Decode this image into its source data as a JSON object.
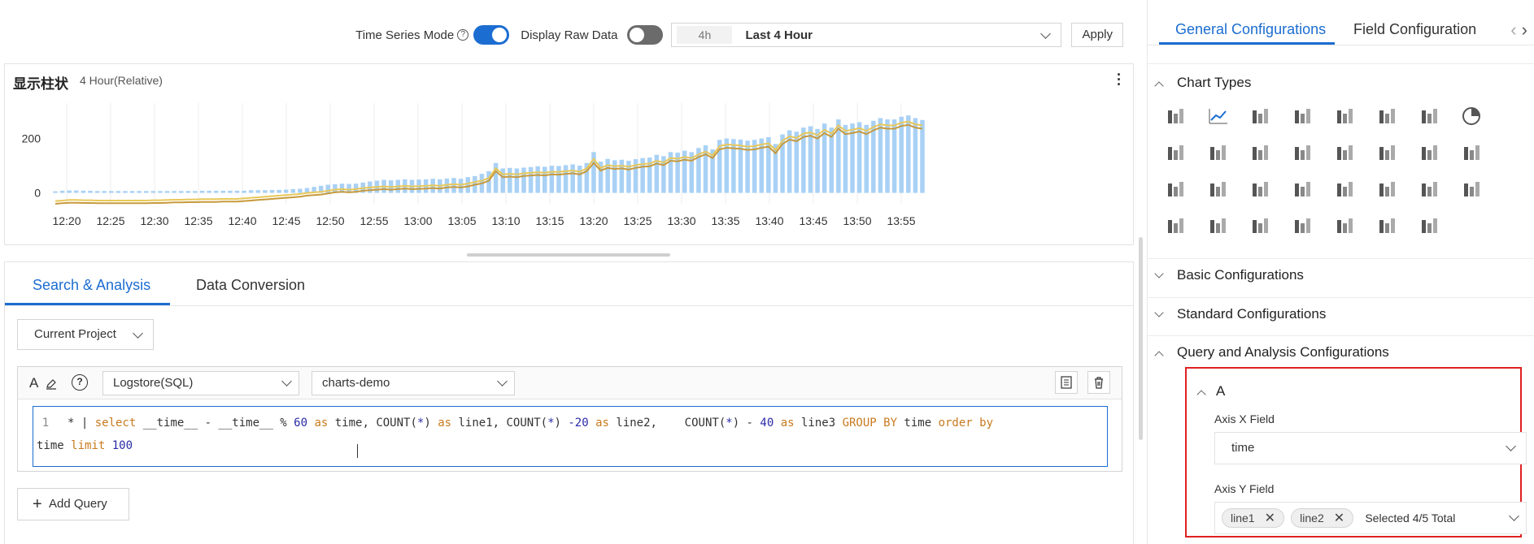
{
  "toolbar": {
    "time_series_label": "Time Series Mode",
    "time_series_on": true,
    "raw_data_label": "Display Raw Data",
    "raw_data_on": false,
    "time_chip": "4h",
    "time_range": "Last 4 Hour",
    "apply_label": "Apply"
  },
  "chart": {
    "title": "显示柱状",
    "subtitle": "4 Hour(Relative)"
  },
  "chart_data": {
    "type": "bar",
    "y_ticks": [
      0,
      200
    ],
    "ylim": [
      -40,
      330
    ],
    "x_ticks": [
      "12:20",
      "12:25",
      "12:30",
      "12:35",
      "12:40",
      "12:45",
      "12:50",
      "12:55",
      "13:00",
      "13:05",
      "13:10",
      "13:15",
      "13:20",
      "13:25",
      "13:30",
      "13:35",
      "13:40",
      "13:45",
      "13:50",
      "13:55"
    ],
    "bar_color": "#a9d1f5",
    "line_colors": [
      "#e8c85a",
      "#c79a3c"
    ],
    "bar_values": [
      6,
      8,
      9,
      9,
      8,
      8,
      7,
      7,
      7,
      7,
      7,
      7,
      7,
      7,
      7,
      7,
      7,
      7,
      7,
      7,
      7,
      8,
      8,
      8,
      8,
      8,
      8,
      8,
      10,
      10,
      10,
      11,
      11,
      12,
      14,
      15,
      18,
      22,
      26,
      30,
      32,
      34,
      33,
      34,
      38,
      42,
      45,
      48,
      46,
      48,
      50,
      48,
      49,
      50,
      52,
      50,
      53,
      55,
      52,
      58,
      62,
      70,
      80,
      110,
      90,
      92,
      90,
      93,
      95,
      98,
      96,
      100,
      99,
      102,
      105,
      100,
      110,
      150,
      115,
      125,
      120,
      122,
      118,
      124,
      128,
      130,
      140,
      135,
      150,
      148,
      155,
      150,
      165,
      175,
      160,
      195,
      200,
      198,
      196,
      192,
      195,
      200,
      205,
      180,
      215,
      230,
      225,
      240,
      245,
      235,
      255,
      240,
      270,
      250,
      255,
      260,
      250,
      265,
      275,
      270,
      270,
      280,
      285,
      275,
      268
    ],
    "line1": [
      -30,
      -28,
      -26,
      -26,
      -27,
      -27,
      -28,
      -28,
      -28,
      -28,
      -28,
      -28,
      -28,
      -28,
      -27,
      -27,
      -26,
      -25,
      -25,
      -24,
      -24,
      -23,
      -23,
      -23,
      -22,
      -22,
      -22,
      -20,
      -18,
      -16,
      -14,
      -12,
      -10,
      -8,
      -6,
      -4,
      0,
      2,
      4,
      8,
      12,
      14,
      12,
      14,
      18,
      20,
      22,
      24,
      22,
      24,
      26,
      24,
      25,
      26,
      28,
      26,
      30,
      32,
      30,
      34,
      40,
      45,
      55,
      90,
      68,
      70,
      68,
      72,
      74,
      76,
      74,
      78,
      77,
      80,
      82,
      78,
      90,
      125,
      92,
      102,
      98,
      100,
      96,
      102,
      106,
      108,
      118,
      112,
      128,
      126,
      132,
      128,
      142,
      152,
      138,
      172,
      178,
      176,
      174,
      170,
      172,
      178,
      182,
      158,
      192,
      208,
      202,
      218,
      222,
      212,
      232,
      218,
      248,
      228,
      232,
      238,
      228,
      242,
      252,
      248,
      248,
      258,
      262,
      252,
      248
    ],
    "line2": [
      -40,
      -38,
      -36,
      -36,
      -37,
      -37,
      -38,
      -38,
      -38,
      -38,
      -38,
      -38,
      -38,
      -38,
      -37,
      -37,
      -36,
      -35,
      -35,
      -34,
      -34,
      -33,
      -33,
      -33,
      -32,
      -32,
      -32,
      -30,
      -28,
      -26,
      -24,
      -22,
      -20,
      -18,
      -16,
      -14,
      -10,
      -8,
      -6,
      -2,
      2,
      4,
      2,
      4,
      8,
      10,
      12,
      14,
      12,
      14,
      16,
      14,
      15,
      16,
      18,
      16,
      20,
      22,
      20,
      24,
      30,
      35,
      45,
      80,
      58,
      60,
      58,
      62,
      64,
      66,
      64,
      68,
      67,
      70,
      72,
      68,
      80,
      110,
      82,
      92,
      88,
      90,
      86,
      92,
      96,
      98,
      108,
      102,
      118,
      116,
      122,
      118,
      132,
      142,
      128,
      160,
      166,
      164,
      162,
      158,
      160,
      166,
      170,
      146,
      180,
      196,
      190,
      206,
      210,
      200,
      220,
      206,
      236,
      216,
      220,
      226,
      216,
      230,
      240,
      236,
      236,
      246,
      250,
      240,
      236
    ]
  },
  "search": {
    "tabs": [
      "Search & Analysis",
      "Data Conversion"
    ],
    "project": "Current Project",
    "store_type": "Logstore(SQL)",
    "logstore": "charts-demo",
    "line_number": "1",
    "query_line1_tokens": [
      {
        "t": "* | ",
        "c": "fn"
      },
      {
        "t": "select",
        "c": "kw"
      },
      {
        "t": " __time__ - __time__ % ",
        "c": "fn"
      },
      {
        "t": "60",
        "c": "num"
      },
      {
        "t": " as ",
        "c": "kw"
      },
      {
        "t": "time, COUNT(",
        "c": "fn"
      },
      {
        "t": "*",
        "c": "num"
      },
      {
        "t": ") ",
        "c": "fn"
      },
      {
        "t": "as",
        "c": "kw"
      },
      {
        "t": " line1, COUNT(",
        "c": "fn"
      },
      {
        "t": "*",
        "c": "num"
      },
      {
        "t": ") ",
        "c": "fn"
      },
      {
        "t": "-20",
        "c": "num"
      },
      {
        "t": " as ",
        "c": "kw"
      },
      {
        "t": "line2,    COUNT(",
        "c": "fn"
      },
      {
        "t": "*",
        "c": "num"
      },
      {
        "t": ") - ",
        "c": "fn"
      },
      {
        "t": "40",
        "c": "num"
      },
      {
        "t": " as ",
        "c": "kw"
      },
      {
        "t": "line3 ",
        "c": "fn"
      },
      {
        "t": "GROUP BY",
        "c": "kw"
      },
      {
        "t": " time ",
        "c": "fn"
      },
      {
        "t": "order by",
        "c": "kw"
      }
    ],
    "query_line2_tokens": [
      {
        "t": "time ",
        "c": "fn"
      },
      {
        "t": "limit",
        "c": "kw"
      },
      {
        "t": " 100",
        "c": "num"
      }
    ],
    "add_query": "Add Query"
  },
  "right": {
    "tabs": [
      "General Configurations",
      "Field Configuration"
    ],
    "chart_types_label": "Chart Types",
    "sections": [
      "Basic Configurations",
      "Standard Configurations",
      "Query and Analysis Configurations"
    ],
    "query_name": "A",
    "axis_x_label": "Axis X Field",
    "axis_x_value": "time",
    "axis_y_label": "Axis Y Field",
    "axis_y_tags": [
      "line1",
      "line2"
    ],
    "axis_y_summary": "Selected 4/5 Total"
  }
}
